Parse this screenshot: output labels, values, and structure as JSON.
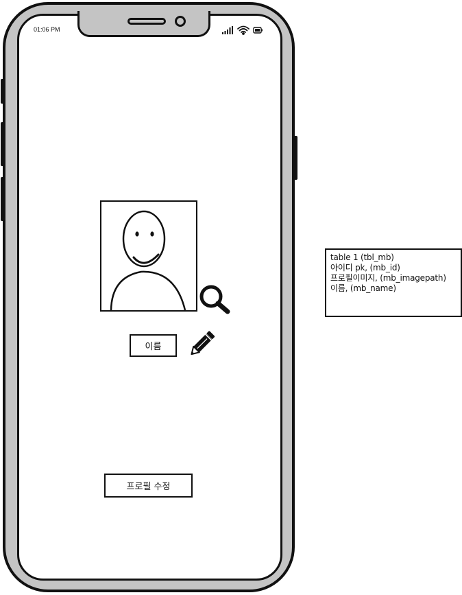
{
  "status_bar": {
    "time": "01:06 PM",
    "icons": [
      "signal-icon",
      "wifi-icon",
      "battery-icon"
    ]
  },
  "profile": {
    "avatar_icon": "user-avatar-icon",
    "search_icon": "search-icon",
    "name_label": "이름",
    "edit_icon": "pencil-icon",
    "edit_button_label": "프로필 수정"
  },
  "note": {
    "lines": [
      "table 1 (tbl_mb)",
      "아이디 pk, (mb_id)",
      "프로필이미지, (mb_imagepath)",
      "이름, (mb_name)"
    ]
  },
  "colors": {
    "frame": "#c4c4c4",
    "stroke": "#111111",
    "screen": "#ffffff"
  }
}
